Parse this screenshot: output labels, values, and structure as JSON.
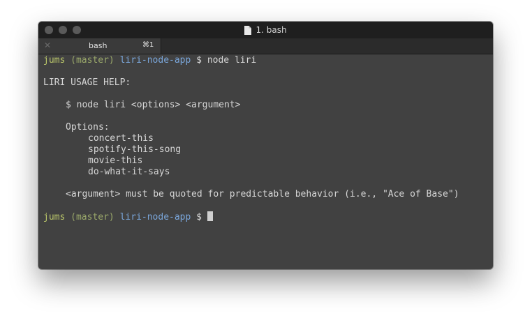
{
  "window": {
    "title": "1. bash"
  },
  "tabs": [
    {
      "label": "bash",
      "shortcut": "⌘1"
    }
  ],
  "terminal": {
    "prompt1": {
      "user": "jums",
      "branch": "(master)",
      "path": "liri-node-app",
      "symbol": "$",
      "command": "node liri"
    },
    "help_title": "LIRI USAGE HELP:",
    "usage": "$ node liri <options> <argument>",
    "options_header": "Options:",
    "options": [
      "concert-this",
      "spotify-this-song",
      "movie-this",
      "do-what-it-says"
    ],
    "note": "<argument> must be quoted for predictable behavior (i.e., \"Ace of Base\")",
    "prompt2": {
      "user": "jums",
      "branch": "(master)",
      "path": "liri-node-app",
      "symbol": "$"
    }
  }
}
